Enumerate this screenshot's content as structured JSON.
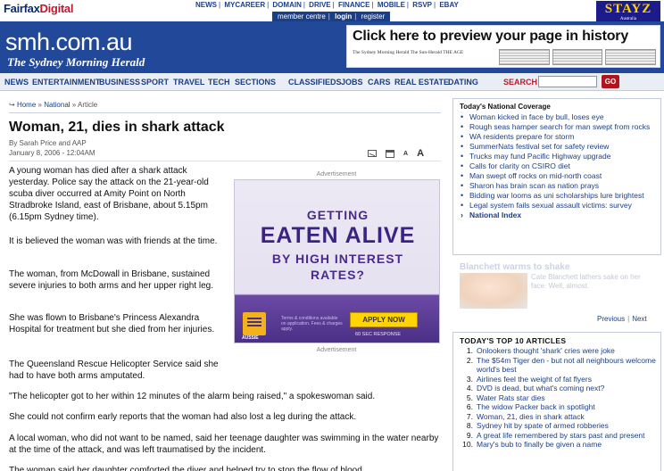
{
  "topbar": {
    "brand_main": "Fairfax",
    "brand_accent": "Digital",
    "links": [
      "NEWS",
      "MYCAREER",
      "DOMAIN",
      "DRIVE",
      "FINANCE",
      "MOBILE",
      "RSVP",
      "EBAY"
    ],
    "member_links": [
      "member centre",
      "login",
      "register"
    ],
    "stayz_ad": {
      "title": "STAYZ",
      "subtitle": "Australia"
    }
  },
  "masthead": {
    "logo": "smh.com.au",
    "subtitle": "The Sydney Morning Herald",
    "history_ad": {
      "headline": "Click here to preview your page in history",
      "papers": "The Sydney Morning Herald  The Sun-Herald  THE AGE"
    }
  },
  "nav": {
    "items": [
      "NEWS",
      "ENTERTAINMENT",
      "BUSINESS",
      "SPORT",
      "TRAVEL",
      "TECH",
      "SECTIONS",
      "CLASSIFIEDS",
      "JOBS",
      "CARS",
      "REAL ESTATE",
      "DATING"
    ],
    "search_label": "SEARCH",
    "search_value": "",
    "go_label": "GO"
  },
  "breadcrumb": {
    "arrow": "↪",
    "items": [
      "Home",
      "National",
      "Article"
    ],
    "separator": "»"
  },
  "article": {
    "headline": "Woman, 21, dies in shark attack",
    "author": "By Sarah Price and AAP",
    "date": "January 8, 2006 - 12:04AM",
    "tools": [
      "A",
      "A"
    ],
    "paragraphs": [
      "A young woman has died after a shark attack yesterday. Police say the attack on the 21-year-old scuba diver occurred at Amity Point on North Stradbroke Island, east of Brisbane, about 5.15pm (6.15pm Sydney time).",
      "It is believed the woman was with friends at the time.",
      "The woman, from McDowall in Brisbane, sustained severe injuries to both arms and her upper right leg.",
      "She was flown to Brisbane's Princess Alexandra Hospital for treatment but she died from her injuries.",
      "The Queensland Rescue Helicopter Service said she had to have both arms amputated.",
      "\"The helicopter got to her within 12 minutes of the alarm being raised,\" a spokeswoman said.",
      "She could not confirm early reports that the woman had also lost a leg during the attack.",
      "A local woman, who did not want to be named, said her teenage daughter was swimming in the water nearby at the time of the attack, and was left traumatised by the incident.",
      "The woman said her daughter comforted the diver and helped try to stop the flow of blood"
    ]
  },
  "advertisement": {
    "label_top": "Advertisement",
    "label_bottom": "Advertisement",
    "line1": "GETTING",
    "line2": "EATEN ALIVE",
    "line3": "BY HIGH INTEREST",
    "line4": "RATES?",
    "brand": "AUSSIE",
    "fine_print": "Terms & conditions available on application. Fees & charges apply.",
    "apply_label": "APPLY NOW",
    "response": "60 SEC RESPONSE"
  },
  "national_coverage": {
    "title": "Today's National Coverage",
    "items": [
      "Woman kicked in face by bull, loses eye",
      "Rough seas hamper search for man swept from rocks",
      "WA residents prepare for storm",
      "SummerNats festival set for safety review",
      "Trucks may fund Pacific Highway upgrade",
      "Calls for clarity on CSIRO diet",
      "Man swept off rocks on mid-north coast",
      "Sharon has brain scan as nation prays",
      "Bidding war looms as uni scholarships lure brightest",
      "Legal system fails sexual assault victims: survey"
    ],
    "index_link": "National Index"
  },
  "blanchett": {
    "title": "Blanchett warms to shake",
    "text": "Cate Blanchett lathers sake on her face. Well, almost.",
    "prev": "Previous",
    "sep": "|",
    "next": "Next"
  },
  "top10": {
    "title": "TODAY'S TOP 10 ARTICLES",
    "items": [
      {
        "num": "1.",
        "text": "Onlookers thought 'shark' cries were joke"
      },
      {
        "num": "2.",
        "text": "The $54m Tiger den - but not all neighbours welcome world's best"
      },
      {
        "num": "3.",
        "text": "Airlines feel the weight of fat flyers"
      },
      {
        "num": "4.",
        "text": "DVD is dead, but what's coming next?"
      },
      {
        "num": "5.",
        "text": "Water Rats star dies"
      },
      {
        "num": "6.",
        "text": "The widow Packer back in spotlight"
      },
      {
        "num": "7.",
        "text": "Woman, 21, dies in shark attack"
      },
      {
        "num": "8.",
        "text": "Sydney hit by spate of armed robberies"
      },
      {
        "num": "9.",
        "text": "A great life remembered by stars past and present"
      },
      {
        "num": "10.",
        "text": "Mary's bub to finally be given a name"
      }
    ]
  }
}
